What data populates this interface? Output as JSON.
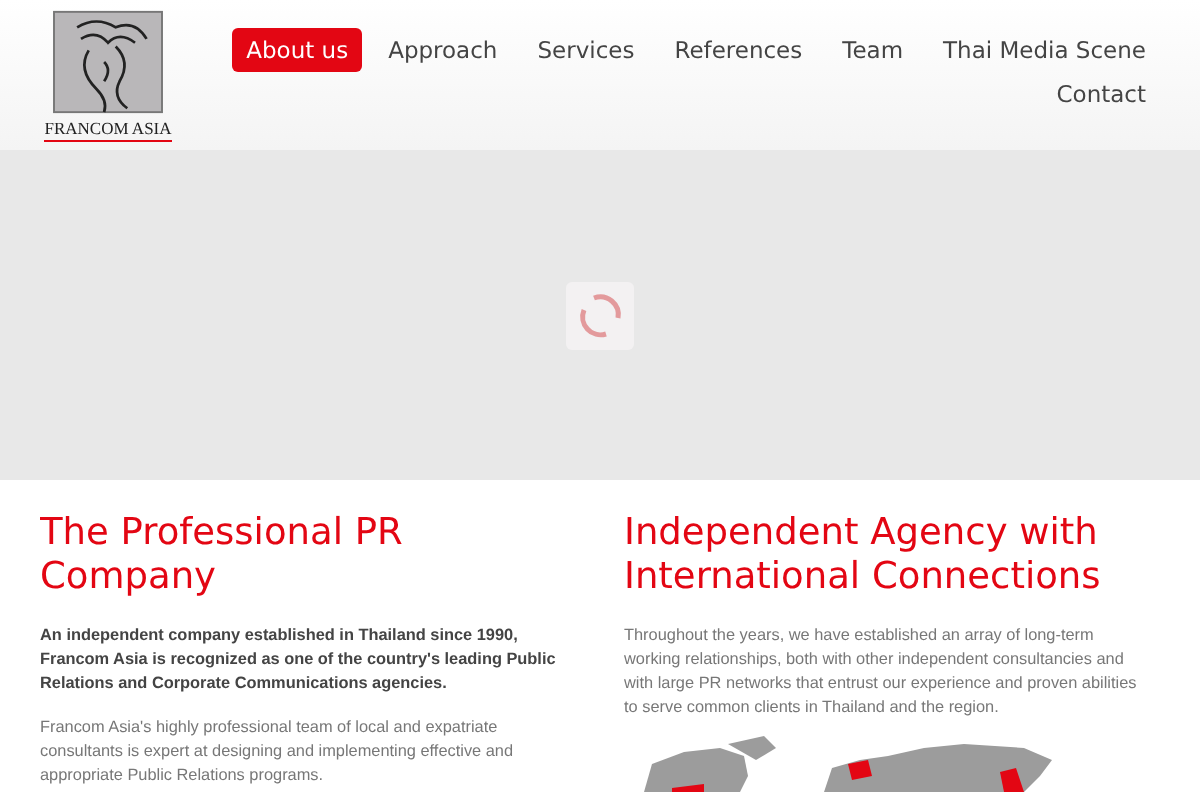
{
  "logo": {
    "text": "FRANCOM ASIA"
  },
  "nav": [
    {
      "label": "About us",
      "selected": true
    },
    {
      "label": "Approach",
      "selected": false
    },
    {
      "label": "Services",
      "selected": false
    },
    {
      "label": "References",
      "selected": false
    },
    {
      "label": "Team",
      "selected": false
    },
    {
      "label": "Thai Media Scene",
      "selected": false
    },
    {
      "label": "Contact",
      "selected": false
    }
  ],
  "slider": {
    "loading": true
  },
  "columns": [
    {
      "heading": "The Professional PR Company",
      "paragraphs": [
        {
          "text": "An independent company established in Thailand since 1990, Francom Asia is recognized as one of the country's leading Public Relations and Corporate Communications agencies.",
          "bold": true
        },
        {
          "text": "Francom Asia's highly professional team of local and expatriate consultants is expert at designing and implementing effective and appropriate Public Relations programs.",
          "bold": false
        }
      ]
    },
    {
      "heading": "Independent Agency with International Connections",
      "paragraphs": [
        {
          "text": "Throughout the years, we have established an array of long-term working relationships, both with other independent consultancies and with large PR networks that entrust our experience and proven abilities to serve common clients in Thailand and the region.",
          "bold": false
        }
      ],
      "map": true
    }
  ]
}
